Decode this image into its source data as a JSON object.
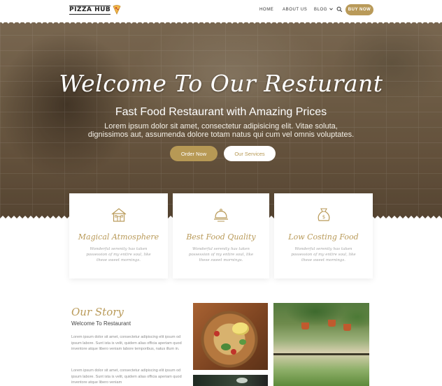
{
  "nav": {
    "logo": "PIZZA HUB",
    "items": [
      "HOME",
      "ABOUT US",
      "BLOG"
    ],
    "buy_label": "BUY NOW"
  },
  "hero": {
    "title": "Welcome To Our Resturant",
    "subtitle": "Fast Food Restaurant with Amazing Prices",
    "text": "Lorem ipsum dolor sit amet, consectetur adipisicing elit. Vitae soluta, dignissimos aut, assumenda dolore totam natus qui cum vel omnis voluptates.",
    "order_label": "Order Now",
    "services_label": "Our Services"
  },
  "features": [
    {
      "icon": "house-icon",
      "title": "Magical Atmosphere",
      "text": "Wonderful serenity has taken possession of my entire soul, like these sweet mornings."
    },
    {
      "icon": "cloche-icon",
      "title": "Best Food Quality",
      "text": "Wonderful serenity has taken possession of my entire soul, like these sweet mornings."
    },
    {
      "icon": "money-bag-icon",
      "title": "Low Costing Food",
      "text": "Wonderful serenity has taken possession of my entire soul, like these sweet mornings."
    }
  ],
  "story": {
    "script_title": "Our Story",
    "subtitle": "Welcome To Restaurant",
    "paragraph_1": "Lorem ipsum dolor sit amet, consectetur adipiscing elit ipsum od ipsum labore. Sunt ista is velit, quidem alias officia aperiam quod inventore atque libero veniam labore temporibus, natus illum in.",
    "paragraph_2": "Lorem ipsum dolor sit amet, consectetur adipiscing elit ipsum od ipsum labore. Sunt ista is velit, quidem alias officia aperiam quod inventore atque libero veniam"
  },
  "colors": {
    "accent": "#b99a59",
    "text_muted": "#8e8e8e"
  }
}
